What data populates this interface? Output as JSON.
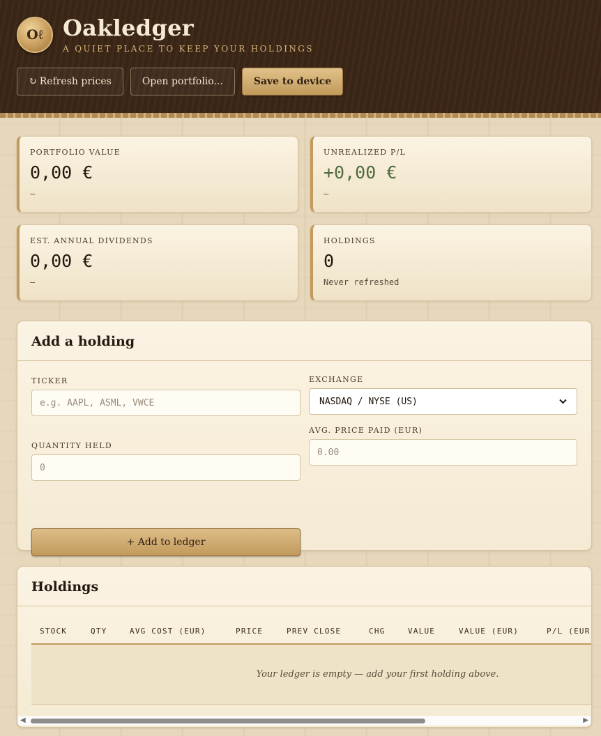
{
  "header": {
    "logo_text": "Oℓ",
    "title": "Oakledger",
    "tagline": "A QUIET PLACE TO KEEP YOUR HOLDINGS",
    "buttons": {
      "refresh_icon": "↻",
      "refresh_label": "Refresh prices",
      "open_label": "Open portfolio...",
      "save_label": "Save to device"
    }
  },
  "stats": {
    "portfolio_value": {
      "label": "PORTFOLIO VALUE",
      "value": "0,00 €",
      "sub": "—"
    },
    "unrealized_pl": {
      "label": "UNREALIZED P/L",
      "value": "+0,00 €",
      "sub": "—"
    },
    "annual_dividends": {
      "label": "EST. ANNUAL DIVIDENDS",
      "value": "0,00 €",
      "sub": "—"
    },
    "holdings": {
      "label": "HOLDINGS",
      "value": "0",
      "sub": "Never refreshed"
    }
  },
  "add_holding": {
    "title": "Add a holding",
    "ticker": {
      "label": "TICKER",
      "placeholder": "e.g. AAPL, ASML, VWCE"
    },
    "exchange": {
      "label": "EXCHANGE",
      "selected": "NASDAQ / NYSE (US)"
    },
    "quantity": {
      "label": "QUANTITY HELD",
      "placeholder": "0"
    },
    "avg_price": {
      "label": "AVG. PRICE PAID (EUR)",
      "placeholder": "0.00"
    },
    "add_button": "+ Add to ledger"
  },
  "holdings_table": {
    "title": "Holdings",
    "columns": [
      "STOCK",
      "QTY",
      "AVG COST (EUR)",
      "PRICE",
      "PREV CLOSE",
      "CHG",
      "VALUE",
      "VALUE (EUR)",
      "P/L (EUR)"
    ],
    "empty_message": "Your ledger is empty — add your first holding above."
  },
  "colors": {
    "header_bg": "#3b2616",
    "accent_gold": "#c29a5c",
    "positive_green": "#4f6b3f",
    "page_bg": "#e7d8bc"
  },
  "icons": {
    "dropdown": "chevron-down-icon",
    "refresh": "refresh-icon",
    "scroll_left": "◀",
    "scroll_right": "▶"
  }
}
